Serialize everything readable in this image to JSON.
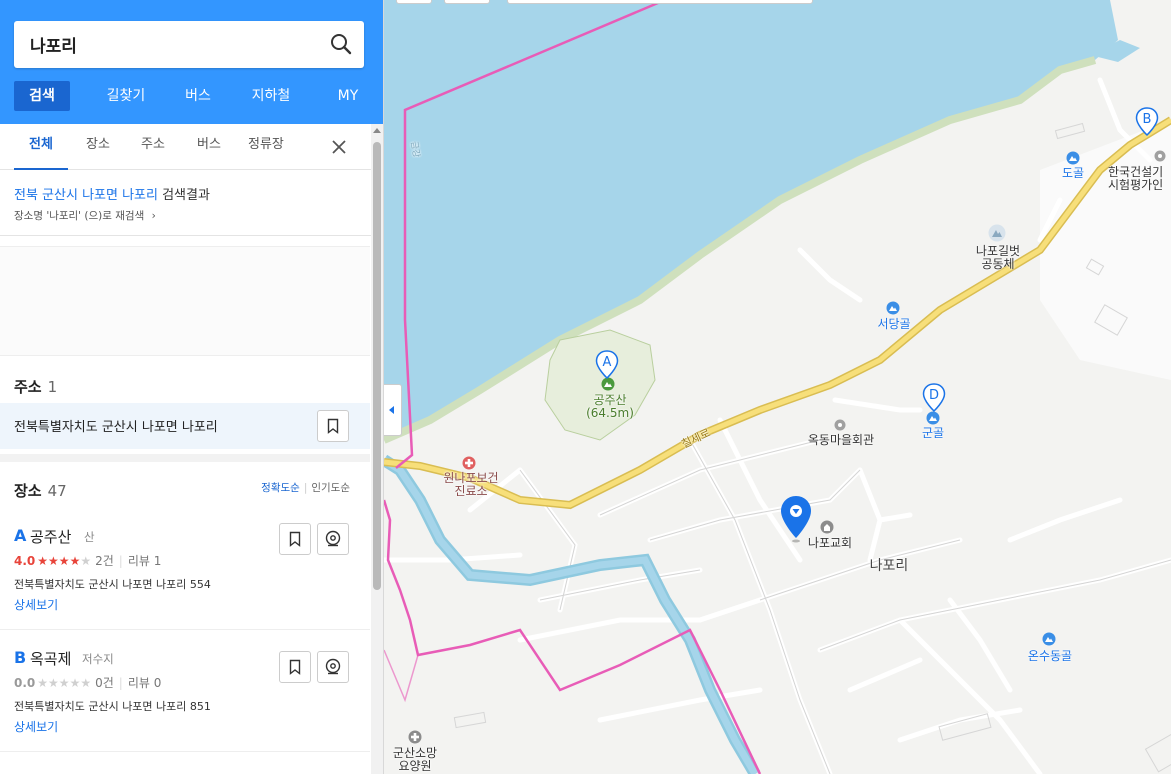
{
  "search": {
    "value": "나포리"
  },
  "nav_tabs": [
    "검색",
    "길찾기",
    "버스",
    "지하철",
    "MY"
  ],
  "filter_tabs": [
    "전체",
    "장소",
    "주소",
    "버스",
    "정류장"
  ],
  "result_info": {
    "query": "전북 군산시 나포면 나포리",
    "suffix": " 검색결과",
    "research": "장소명 '나포리' (으)로 재검색"
  },
  "address_section": {
    "title": "주소",
    "count": "1",
    "address": "전북특별자치도 군산시 나포면 나포리"
  },
  "place_section": {
    "title": "장소",
    "count": "47",
    "sort_accuracy": "정확도순",
    "sort_popular": "인기도순"
  },
  "places": [
    {
      "letter": "A",
      "name": "공주산",
      "category": "산",
      "score": "4.0",
      "rating": 4,
      "count": "2건",
      "review": "리뷰 1",
      "address": "전북특별자치도 군산시 나포면 나포리 554",
      "detail": "상세보기"
    },
    {
      "letter": "B",
      "name": "옥곡제",
      "category": "저수지",
      "score": "0.0",
      "rating": 0,
      "count": "0건",
      "review": "리뷰 0",
      "address": "전북특별자치도 군산시 나포면 나포리 851",
      "detail": "상세보기"
    }
  ],
  "map_labels": {
    "gongjusan": "공주산",
    "gongjusan_height": "(64.5m)",
    "wonnapo_1": "원나포보건",
    "wonnapo_2": "진료소",
    "okdong": "옥동마을회관",
    "church": "나포교회",
    "napori": "나포리",
    "seodanggol": "서당골",
    "gungol": "군골",
    "dogol": "도골",
    "napogilbeot_1": "나포길벗",
    "napogilbeot_2": "공동체",
    "hanguk_1": "한국건설기",
    "hanguk_2": "시험평가인",
    "onsudong": "온수동골",
    "gunsan_1": "군산소망",
    "gunsan_2": "요양원",
    "road": "칠세로",
    "river": "금강"
  },
  "markers": {
    "a": "A",
    "b": "B",
    "d": "D"
  },
  "colors": {
    "water": "#a6d5ea",
    "land": "#f3f3f1",
    "road_yellow": "#f7df7a",
    "boundary": "#e85cb7",
    "accent": "#3396ff"
  }
}
